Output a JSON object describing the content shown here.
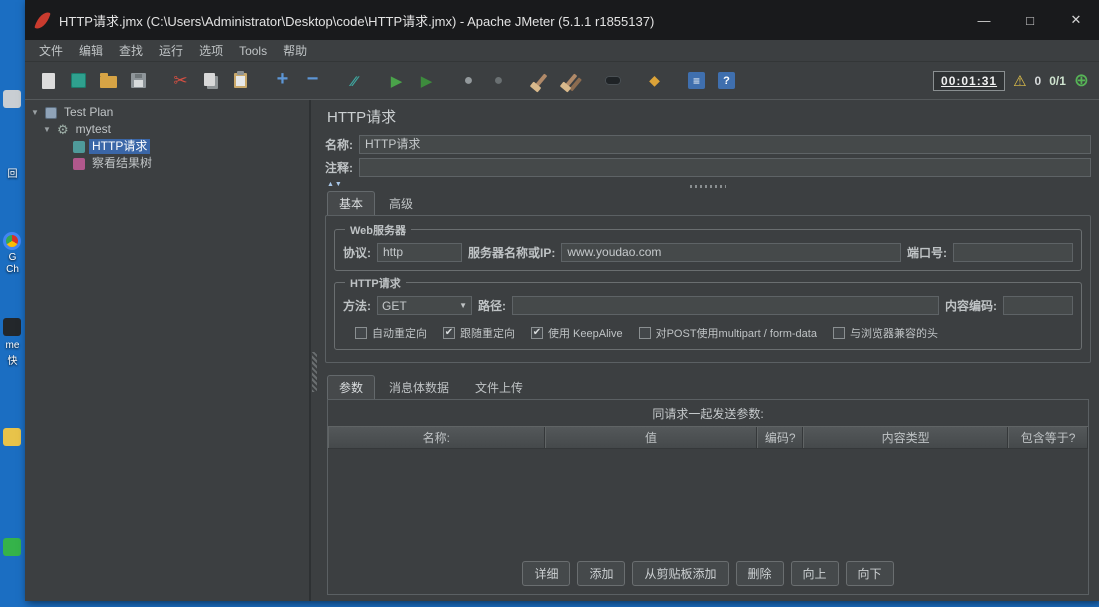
{
  "colors": {
    "desktop_blue": "#1b6ec2",
    "selection_blue": "#3a66a7",
    "accent_green": "#4aa34a",
    "warning_yellow": "#e6c54a"
  },
  "icons": {
    "cut": "✂",
    "add": "+",
    "remove": "−",
    "toggle": "∕∕",
    "start": "▶",
    "start_no_timers": "▶",
    "stop": "●",
    "shutdown": "●",
    "search_reset": "◆",
    "function_helper": "≡",
    "help": "?",
    "warning": "⚠",
    "threads_target": "⊕",
    "expander": "▼",
    "gear": "⚙",
    "select_arrow": "▼",
    "collapse": "▲▼"
  },
  "desktop": {
    "labels": [
      "回",
      "G",
      "Ch",
      "me",
      "快"
    ]
  },
  "window": {
    "title": "HTTP请求.jmx (C:\\Users\\Administrator\\Desktop\\code\\HTTP请求.jmx) - Apache JMeter (5.1.1 r1855137)",
    "controls": {
      "minimize": "—",
      "maximize": "□",
      "close": "✕"
    }
  },
  "menu": {
    "items": [
      "文件",
      "编辑",
      "查找",
      "运行",
      "选项",
      "Tools",
      "帮助"
    ]
  },
  "toolbar": {
    "timer": "00:01:31",
    "warning_count": "0",
    "threads": "0/1"
  },
  "tree": {
    "items": [
      {
        "label": "Test Plan",
        "selected": false
      },
      {
        "label": "mytest",
        "selected": false
      },
      {
        "label": "HTTP请求",
        "selected": true
      },
      {
        "label": "察看结果树",
        "selected": false
      }
    ]
  },
  "main": {
    "title": "HTTP请求",
    "name": {
      "label": "名称:",
      "value": "HTTP请求"
    },
    "comment": {
      "label": "注释:",
      "value": ""
    },
    "tabs": [
      "基本",
      "高级"
    ],
    "web_server": {
      "legend": "Web服务器",
      "protocol_label": "协议:",
      "protocol_value": "http",
      "server_label": "服务器名称或IP:",
      "server_value": "www.youdao.com",
      "port_label": "端口号:",
      "port_value": ""
    },
    "http_request": {
      "legend": "HTTP请求",
      "method_label": "方法:",
      "method_value": "GET",
      "path_label": "路径:",
      "path_value": "",
      "encoding_label": "内容编码:",
      "encoding_value": "",
      "checkboxes": [
        {
          "label": "自动重定向",
          "checked": false
        },
        {
          "label": "跟随重定向",
          "checked": true
        },
        {
          "label": "使用 KeepAlive",
          "checked": true
        },
        {
          "label": "对POST使用multipart / form-data",
          "checked": false
        },
        {
          "label": "与浏览器兼容的头",
          "checked": false
        }
      ]
    },
    "param_tabs": [
      "参数",
      "消息体数据",
      "文件上传"
    ],
    "table": {
      "title": "同请求一起发送参数:",
      "columns": [
        "名称:",
        "值",
        "编码?",
        "内容类型",
        "包含等于?"
      ]
    },
    "buttons": [
      "详细",
      "添加",
      "从剪贴板添加",
      "删除",
      "向上",
      "向下"
    ]
  }
}
